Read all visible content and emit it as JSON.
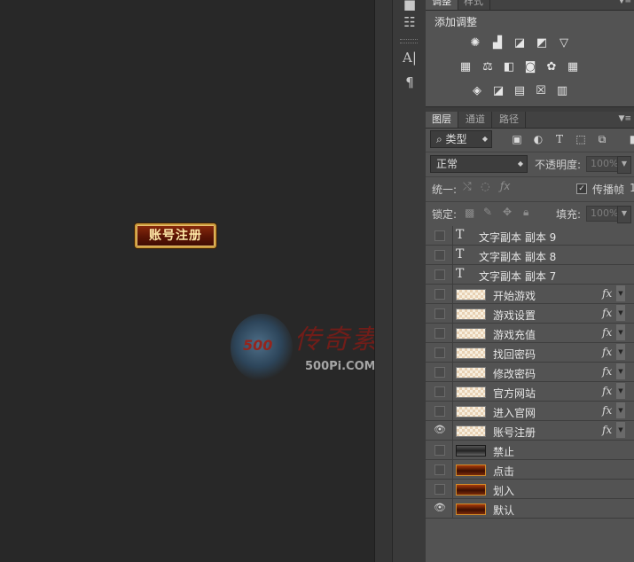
{
  "canvas": {
    "preview_button_label": "账号注册",
    "watermark": {
      "logo_text": "500",
      "script_text": "传奇素材",
      "url": "500Pi.COM"
    }
  },
  "panel": {
    "top_tabs": [
      "调整",
      "样式"
    ],
    "adjustments_title": "添加调整",
    "adjustment_icons": [
      [
        "brightness-icon",
        "levels-icon",
        "curves-icon",
        "exposure-icon",
        "vibrance-icon"
      ],
      [
        "hue-saturation-icon",
        "color-balance-icon",
        "black-white-icon",
        "photo-filter-icon",
        "channel-mixer-icon",
        "color-lookup-icon"
      ],
      [
        "invert-icon",
        "posterize-icon",
        "threshold-icon",
        "selective-color-icon",
        "gradient-map-icon"
      ]
    ],
    "layer_tabs": [
      "图层",
      "通道",
      "路径"
    ],
    "filter_type": "类型",
    "blend_mode": "正常",
    "opacity_label": "不透明度:",
    "opacity_value": "100%",
    "unify_label": "统一:",
    "propagate_label": "传播帧",
    "propagate_suffix": "1",
    "lock_label": "锁定:",
    "fill_label": "填充:",
    "fill_value": "100%"
  },
  "layers": [
    {
      "name": "文字副本 副本 9",
      "kind": "text",
      "visible": false,
      "fx": false
    },
    {
      "name": "文字副本 副本 8",
      "kind": "text",
      "visible": false,
      "fx": false
    },
    {
      "name": "文字副本 副本 7",
      "kind": "text",
      "visible": false,
      "fx": false
    },
    {
      "name": "开始游戏",
      "kind": "checker",
      "visible": false,
      "fx": true
    },
    {
      "name": "游戏设置",
      "kind": "checker",
      "visible": false,
      "fx": true
    },
    {
      "name": "游戏充值",
      "kind": "checker",
      "visible": false,
      "fx": true
    },
    {
      "name": "找回密码",
      "kind": "checker",
      "visible": false,
      "fx": true
    },
    {
      "name": "修改密码",
      "kind": "checker",
      "visible": false,
      "fx": true
    },
    {
      "name": "官方网站",
      "kind": "checker",
      "visible": false,
      "fx": true
    },
    {
      "name": "进入官网",
      "kind": "checker",
      "visible": false,
      "fx": true
    },
    {
      "name": "账号注册",
      "kind": "checker",
      "visible": true,
      "fx": true
    },
    {
      "name": "禁止",
      "kind": "disabled",
      "visible": false,
      "fx": false
    },
    {
      "name": "点击",
      "kind": "button",
      "visible": false,
      "fx": false
    },
    {
      "name": "划入",
      "kind": "button",
      "visible": false,
      "fx": false
    },
    {
      "name": "默认",
      "kind": "button",
      "visible": true,
      "fx": false
    }
  ],
  "icons": {
    "eye": "eye-icon",
    "text_layer": "text-layer-icon",
    "fx": "fx-icon"
  }
}
